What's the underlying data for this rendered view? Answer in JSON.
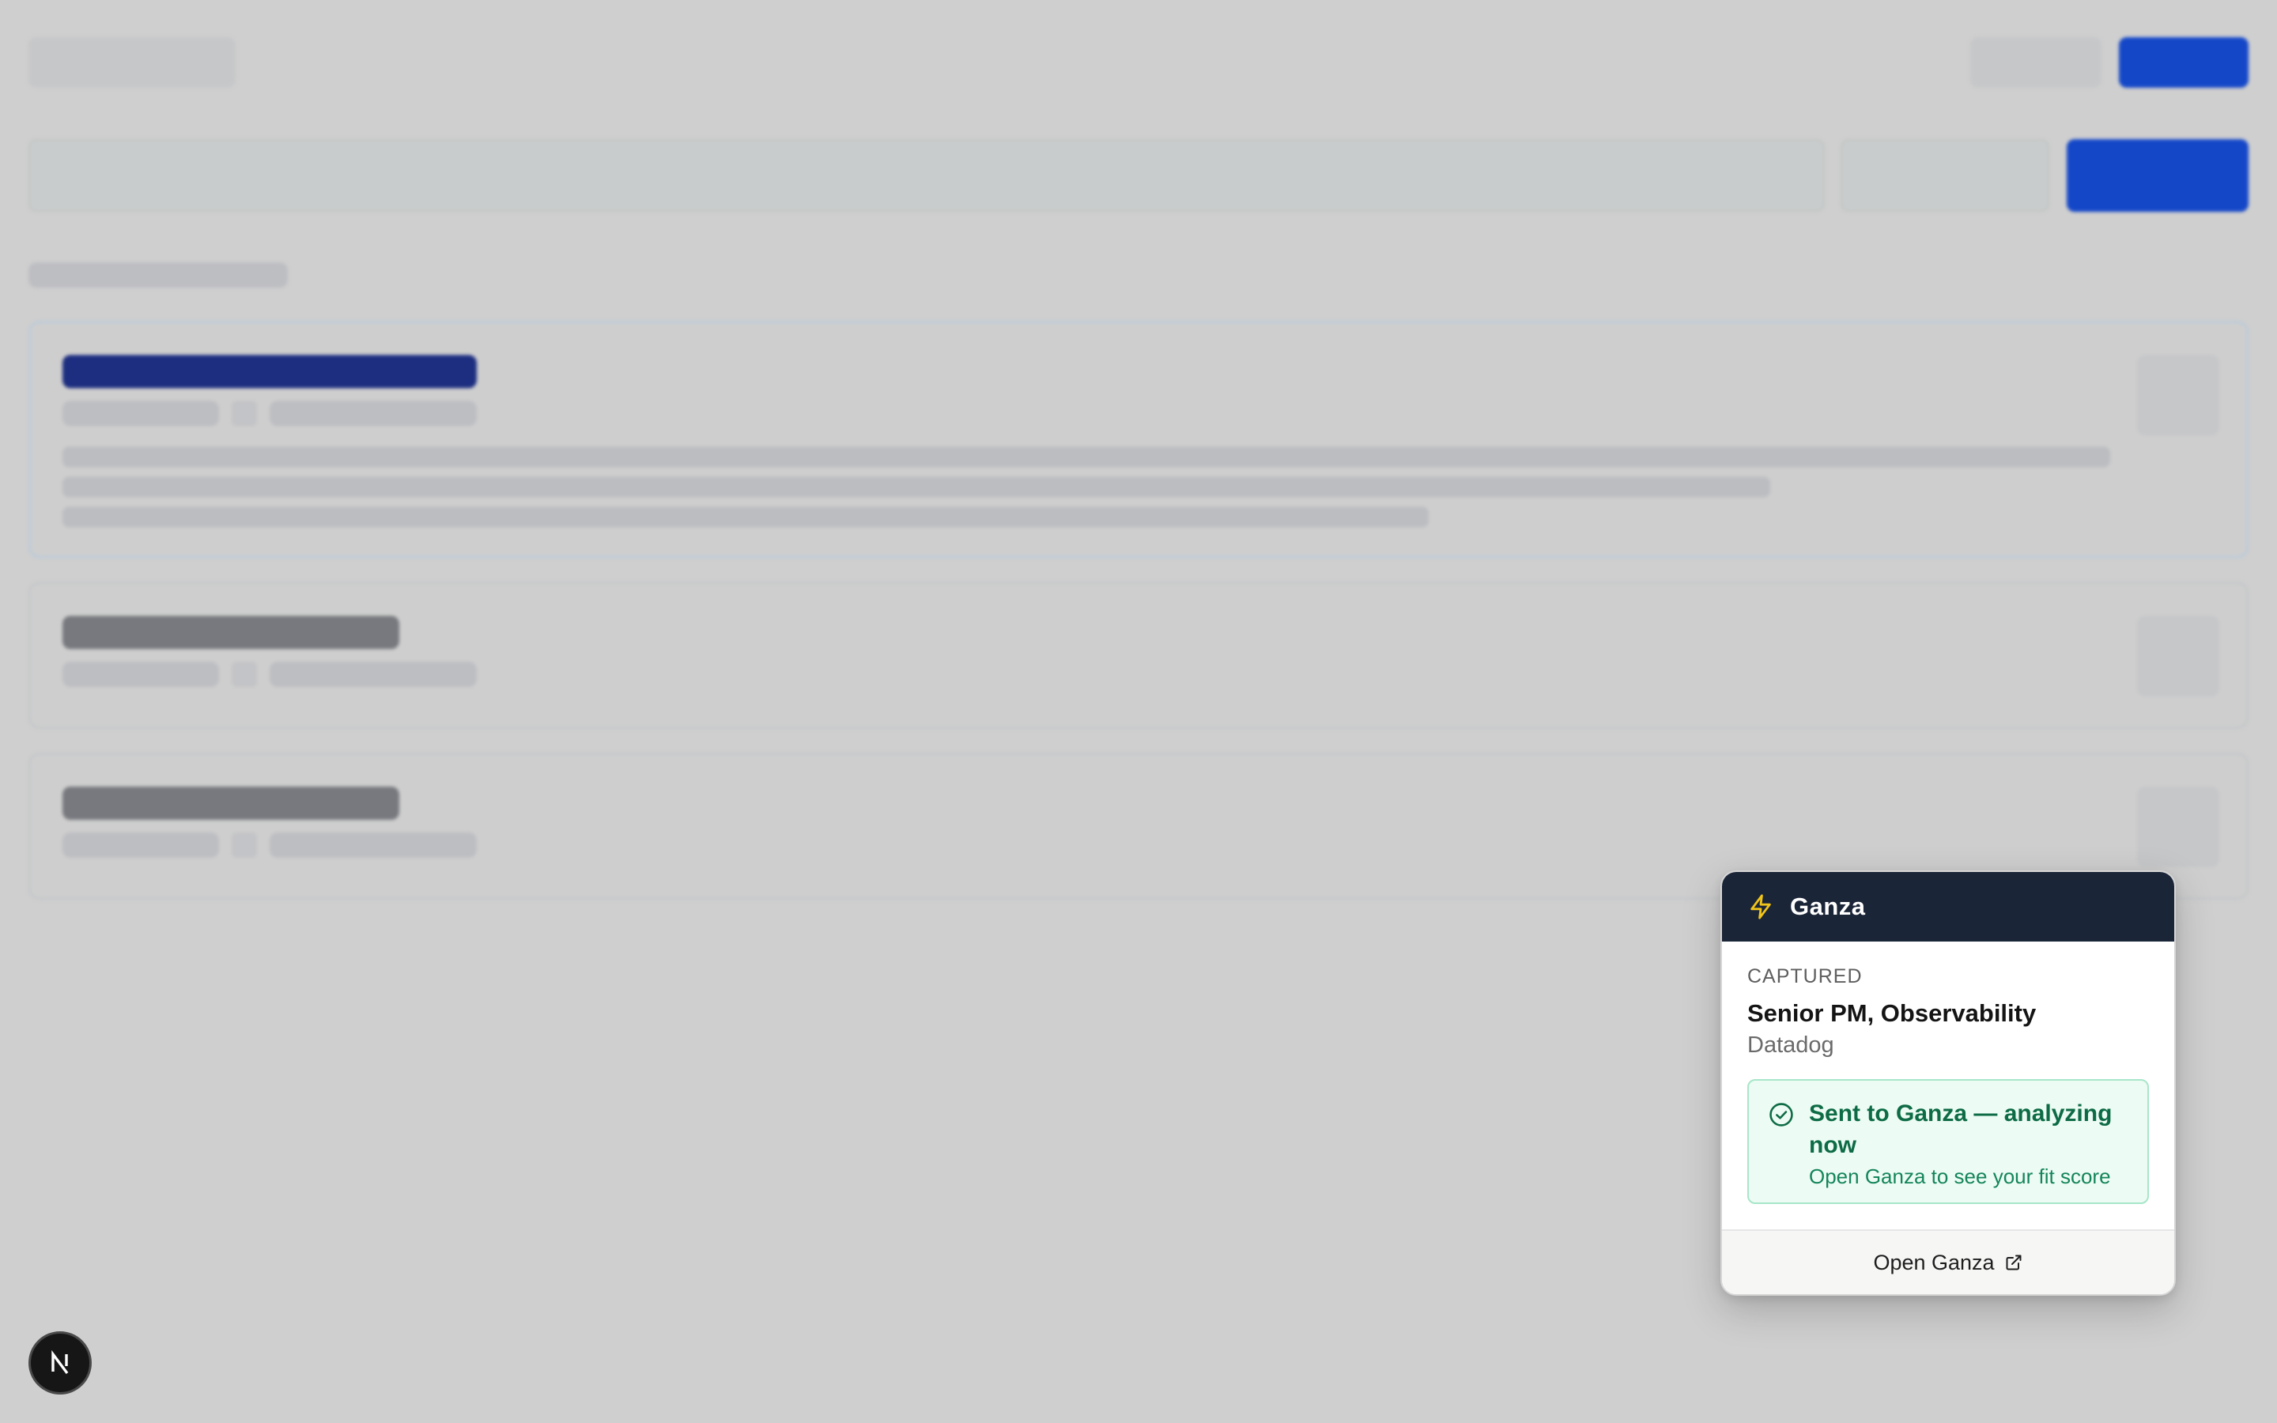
{
  "popup": {
    "brand": "Ganza",
    "captured_label": "CAPTURED",
    "job_title": "Senior PM, Observability",
    "company": "Datadog",
    "status_message": "Sent to Ganza — analyzing now",
    "status_hint": "Open Ganza to see your fit score",
    "open_link_label": "Open Ganza",
    "header_bg": "#1b2538",
    "accent_bolt_color": "#f0c419",
    "success_color": "#0d6b45"
  },
  "icons": {
    "header": "lightning-bolt-icon",
    "status": "check-circle-icon",
    "open_link": "external-link-icon",
    "framework_badge": "nextjs-logo-icon"
  },
  "background": {
    "state": "blurred placeholder page",
    "primary_color": "#1447c8"
  }
}
